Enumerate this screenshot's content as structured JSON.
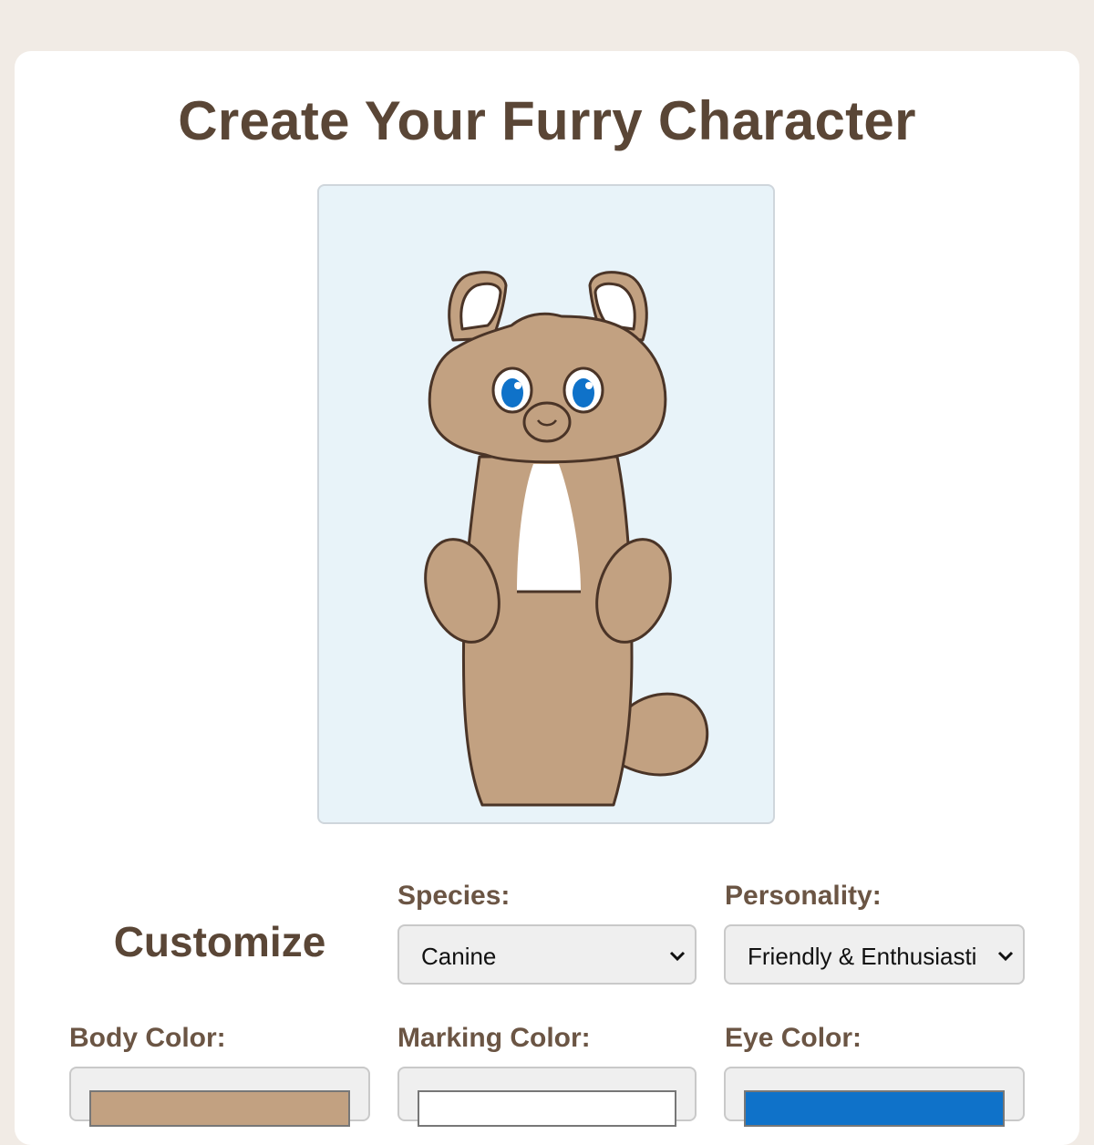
{
  "page": {
    "title": "Create Your Furry Character"
  },
  "preview": {
    "species": "Canine",
    "colors": {
      "body": "#c2a181",
      "marking": "#ffffff",
      "eye": "#0f72c9",
      "outline": "#4a3427",
      "ear_inner": "#ffffff",
      "background": "#e8f3f9"
    }
  },
  "customize": {
    "heading": "Customize",
    "species": {
      "label": "Species:",
      "value": "Canine"
    },
    "personality": {
      "label": "Personality:",
      "value": "Friendly & Enthusiasti"
    },
    "body_color": {
      "label": "Body Color:",
      "value": "#c2a181"
    },
    "marking_color": {
      "label": "Marking Color:",
      "value": "#ffffff"
    },
    "eye_color": {
      "label": "Eye Color:",
      "value": "#0f72c9"
    }
  }
}
